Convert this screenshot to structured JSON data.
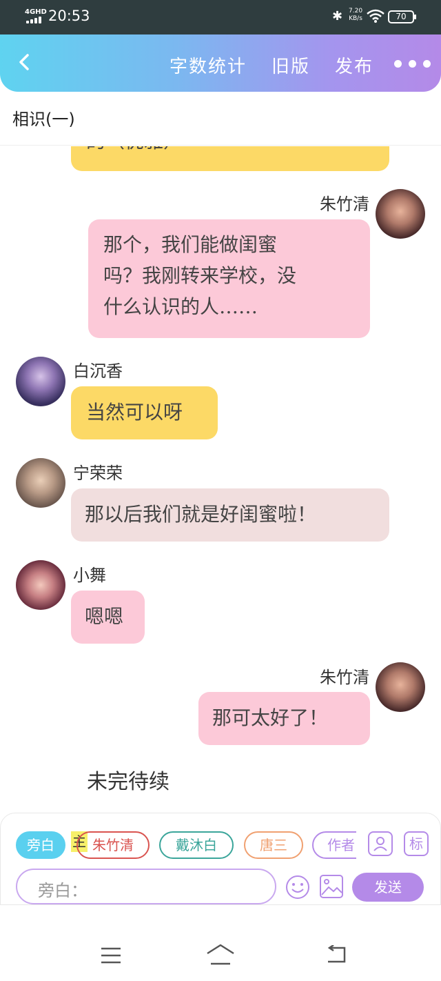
{
  "status_bar": {
    "network": "4GHD",
    "time": "20:53",
    "speed_value": "7.20",
    "speed_unit": "KB/s",
    "battery": "70"
  },
  "header": {
    "word_count": "字数统计",
    "old_version": "旧版",
    "publish": "发布"
  },
  "chapter_title": "相识(一)",
  "messages": [
    {
      "side": "left",
      "name": "",
      "text": "的（优雅）",
      "color": "#fcd966"
    },
    {
      "side": "right",
      "name": "朱竹清",
      "lines": [
        "那个，我们能做闺蜜",
        "吗？我刚转来学校，没",
        "什么认识的人……"
      ],
      "color": "#fcc9d8"
    },
    {
      "side": "left",
      "name": "白沉香",
      "text": "当然可以呀",
      "color": "#fcd966"
    },
    {
      "side": "left",
      "name": "宁荣荣",
      "text": "那以后我们就是好闺蜜啦！",
      "color": "#f1dede"
    },
    {
      "side": "left",
      "name": "小舞",
      "text": "嗯嗯",
      "color": "#fcc9d8"
    },
    {
      "side": "right",
      "name": "朱竹清",
      "text": "那可太好了！",
      "color": "#fcc9d8"
    }
  ],
  "to_be_continued": "未完待续",
  "role_chips": [
    {
      "label": "旁白",
      "color": "#5ad0ef",
      "filled": true
    },
    {
      "label": "朱竹清",
      "color": "#d9534f",
      "filled": false
    },
    {
      "label": "戴沐白",
      "color": "#3aa59a",
      "filled": false
    },
    {
      "label": "唐三",
      "color": "#f0a070",
      "filled": false
    },
    {
      "label": "作者",
      "color": "#b48ae8",
      "filled": false
    }
  ],
  "main_marker": "主",
  "tag_button": "标",
  "input_placeholder": "旁白：",
  "send_label": "发送"
}
